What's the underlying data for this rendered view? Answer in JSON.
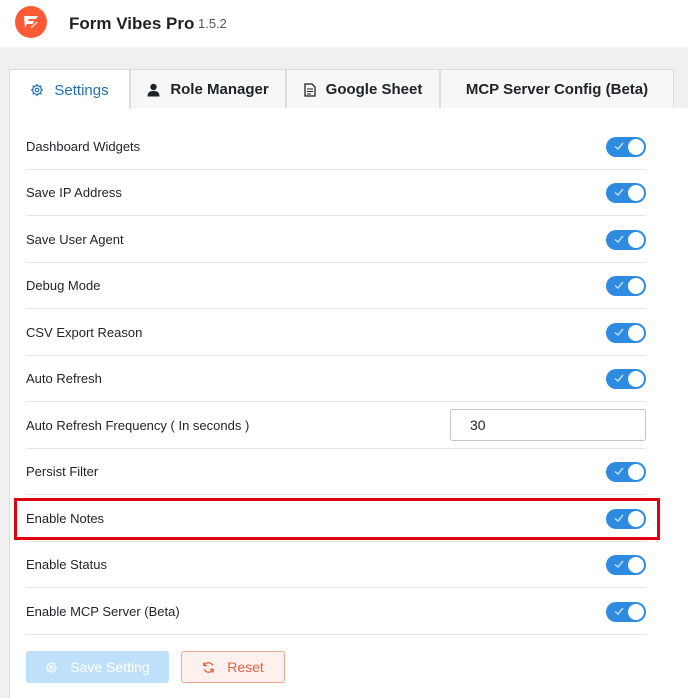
{
  "app": {
    "name": "Form Vibes Pro",
    "version": "1.5.2",
    "logo_icon": "form-vibes-logo",
    "brand_color": "#ff5a36"
  },
  "tabs": [
    {
      "label": "Settings",
      "icon": "gear-icon",
      "active": true
    },
    {
      "label": "Role Manager",
      "icon": "user-icon",
      "active": false
    },
    {
      "label": "Google Sheet",
      "icon": "document-icon",
      "active": false
    },
    {
      "label": "MCP Server Config (Beta)",
      "icon": "",
      "active": false
    }
  ],
  "settings": {
    "dashboard_widgets": {
      "label": "Dashboard Widgets",
      "enabled": true
    },
    "save_ip": {
      "label": "Save IP Address",
      "enabled": true
    },
    "save_user_agent": {
      "label": "Save User Agent",
      "enabled": true
    },
    "debug_mode": {
      "label": "Debug Mode",
      "enabled": true
    },
    "csv_export_reason": {
      "label": "CSV Export Reason",
      "enabled": true
    },
    "auto_refresh": {
      "label": "Auto Refresh",
      "enabled": true
    },
    "auto_refresh_frequency": {
      "label": "Auto Refresh Frequency ( In seconds )",
      "value": "30"
    },
    "persist_filter": {
      "label": "Persist Filter",
      "enabled": true
    },
    "enable_notes": {
      "label": "Enable Notes",
      "enabled": true
    },
    "enable_status": {
      "label": "Enable Status",
      "enabled": true
    },
    "enable_mcp_server": {
      "label": "Enable MCP Server (Beta)",
      "enabled": true
    }
  },
  "buttons": {
    "save_label": "Save Setting",
    "reset_label": "Reset"
  },
  "colors": {
    "toggle_on": "#2f8be0",
    "highlight": "#e0000f",
    "active_tab": "#2271b1",
    "reset": "#e5603d"
  }
}
